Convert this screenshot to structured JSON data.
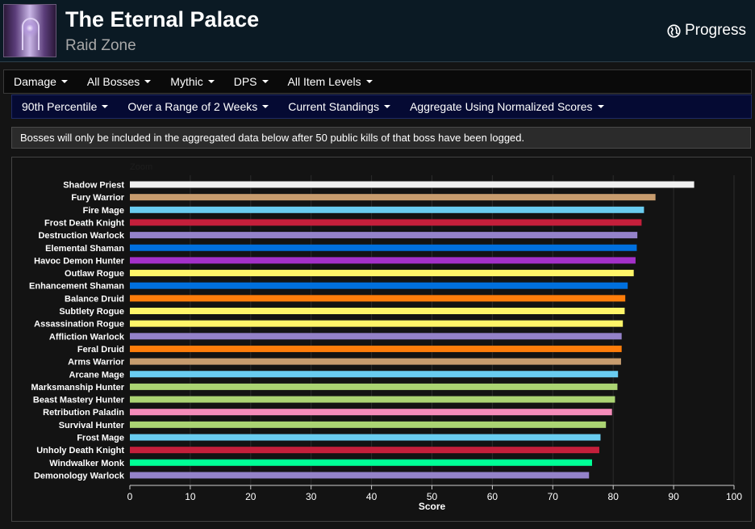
{
  "header": {
    "title": "The Eternal Palace",
    "subtitle": "Raid Zone",
    "progress_label": "Progress"
  },
  "filters_primary": [
    {
      "label": "Damage"
    },
    {
      "label": "All Bosses"
    },
    {
      "label": "Mythic"
    },
    {
      "label": "DPS"
    },
    {
      "label": "All Item Levels"
    }
  ],
  "filters_secondary": [
    {
      "label": "90th Percentile"
    },
    {
      "label": "Over a Range of 2 Weeks"
    },
    {
      "label": "Current Standings"
    },
    {
      "label": "Aggregate Using Normalized Scores"
    }
  ],
  "notice": "Bosses will only be included in the aggregated data below after 50 public kills of that boss have been logged.",
  "chart_data": {
    "type": "bar",
    "orientation": "horizontal",
    "zoom_label": "Zoom",
    "xlabel": "Score",
    "xlim": [
      0,
      100
    ],
    "xticks": [
      0,
      10,
      20,
      30,
      40,
      50,
      60,
      70,
      80,
      90,
      100
    ],
    "grid": true,
    "categories": [
      "Shadow Priest",
      "Fury Warrior",
      "Fire Mage",
      "Frost Death Knight",
      "Destruction Warlock",
      "Elemental Shaman",
      "Havoc Demon Hunter",
      "Outlaw Rogue",
      "Enhancement Shaman",
      "Balance Druid",
      "Subtlety Rogue",
      "Assassination Rogue",
      "Affliction Warlock",
      "Feral Druid",
      "Arms Warrior",
      "Arcane Mage",
      "Marksmanship Hunter",
      "Beast Mastery Hunter",
      "Retribution Paladin",
      "Survival Hunter",
      "Frost Mage",
      "Unholy Death Knight",
      "Windwalker Monk",
      "Demonology Warlock"
    ],
    "values": [
      93.4,
      87.0,
      85.1,
      84.7,
      84.0,
      83.9,
      83.7,
      83.4,
      82.4,
      82.0,
      81.9,
      81.6,
      81.4,
      81.4,
      81.3,
      80.8,
      80.7,
      80.3,
      79.8,
      78.8,
      77.9,
      77.7,
      76.5,
      76.0
    ],
    "colors": [
      "#f0f0f0",
      "#c79c6e",
      "#69ccf0",
      "#c41f3b",
      "#9482c9",
      "#0070de",
      "#a330c9",
      "#fff569",
      "#0070de",
      "#ff7d0a",
      "#fff569",
      "#fff569",
      "#9482c9",
      "#ff7d0a",
      "#c79c6e",
      "#69ccf0",
      "#abd473",
      "#abd473",
      "#f58cba",
      "#abd473",
      "#69ccf0",
      "#c41f3b",
      "#00ff96",
      "#9482c9"
    ]
  }
}
